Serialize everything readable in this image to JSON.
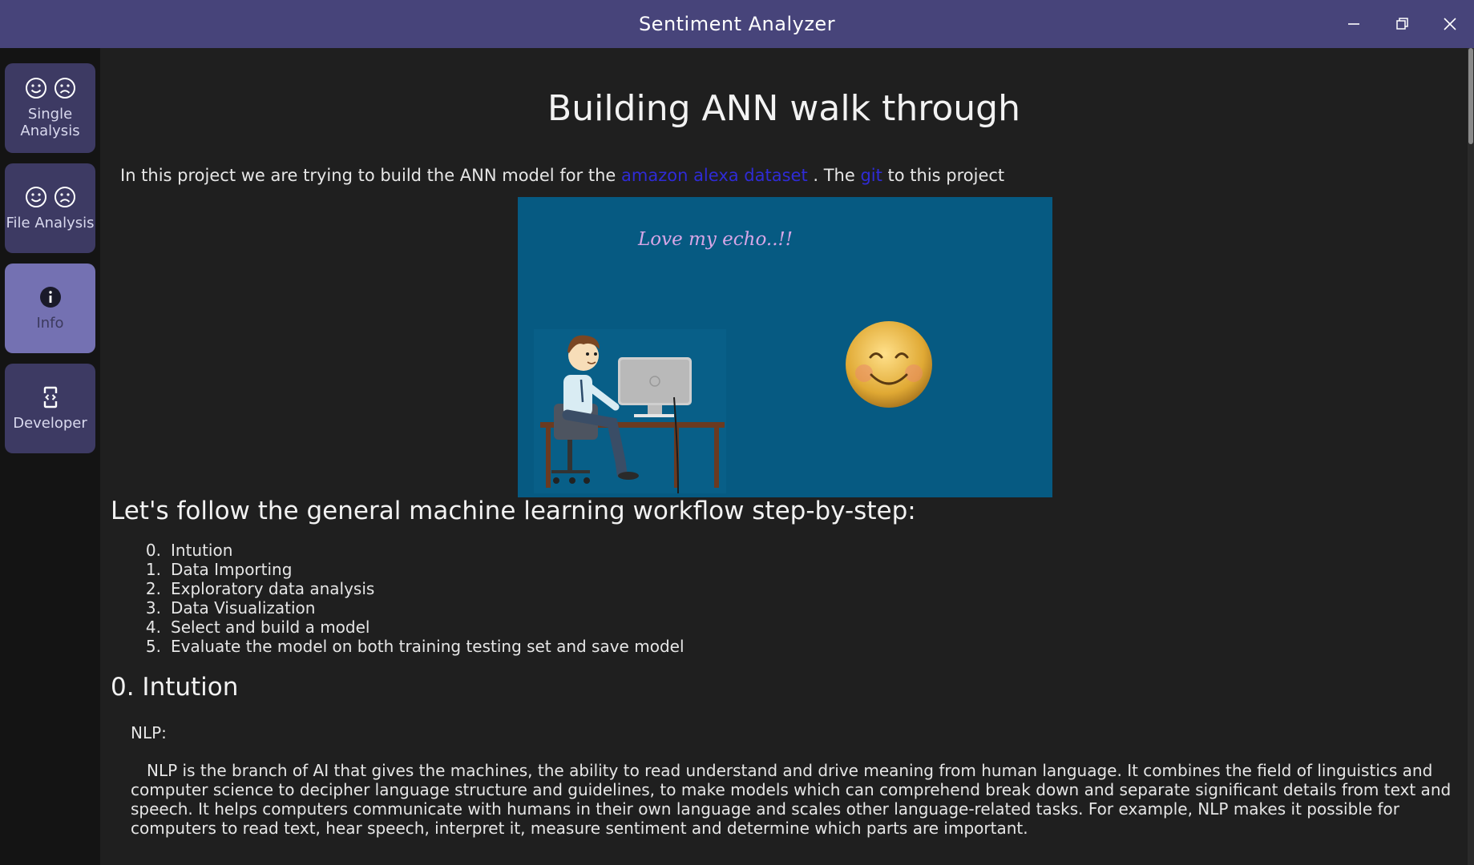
{
  "window": {
    "title": "Sentiment Analyzer",
    "controls": {
      "minimize_icon": "minimize-icon",
      "maximize_icon": "restore-icon",
      "close_icon": "close-icon"
    }
  },
  "sidebar": {
    "items": [
      {
        "label_line1": "Single",
        "label_line2": "Analysis",
        "icons": [
          "smile-icon",
          "frown-icon"
        ],
        "active": false
      },
      {
        "label": "File Analysis",
        "icons": [
          "smile-icon",
          "frown-icon"
        ],
        "active": false
      },
      {
        "label": "Info",
        "icons": [
          "info-icon"
        ],
        "active": true
      },
      {
        "label": "Developer",
        "icons": [
          "developer-icon"
        ],
        "active": false
      }
    ]
  },
  "main": {
    "title": "Building ANN walk through",
    "intro": {
      "prefix": "In this project we are trying to build the ANN model for the ",
      "dataset_link": "amazon alexa dataset",
      "middle": " . The ",
      "git_link": "git",
      "suffix": " to this project"
    },
    "hero": {
      "caption": "Love my echo..!!"
    },
    "workflow_heading": "Let's follow the general machine learning workflow step-by-step:",
    "steps": [
      {
        "num": "0.",
        "text": "Intution"
      },
      {
        "num": "1.",
        "text": "Data Importing"
      },
      {
        "num": "2.",
        "text": "Exploratory data analysis"
      },
      {
        "num": "3.",
        "text": "Data Visualization"
      },
      {
        "num": "4.",
        "text": "Select and build a model"
      },
      {
        "num": "5.",
        "text": "Evaluate the model on both training testing set and save model"
      }
    ],
    "section_heading": "0. Intution",
    "nlp_label": "NLP:",
    "paragraph": "NLP is the branch of AI that gives the machines, the ability to read understand and drive meaning from human language. It combines the field of linguistics and computer science to decipher language structure and guidelines, to make models which can comprehend break down and separate significant details from text and speech. It helps computers communicate with humans in their own language and scales other language-related tasks. For example, NLP makes it possible for computers to read text, hear speech, interpret it, measure sentiment and determine which parts are important."
  },
  "colors": {
    "titlebar": "#47447a",
    "sidebar_item": "#3d3a63",
    "sidebar_item_active": "#7471b2",
    "link": "#2f2bd6",
    "hero_background": "#065a82"
  }
}
